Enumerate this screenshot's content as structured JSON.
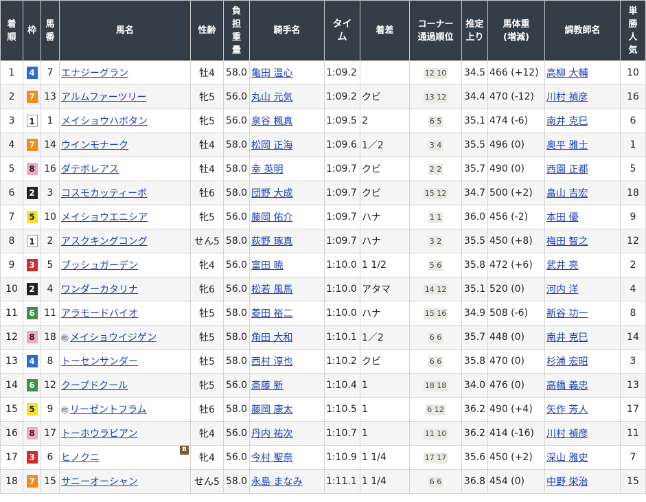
{
  "headers": {
    "rank": "着順",
    "waku": "枠",
    "umaban": "馬番",
    "horse": "馬名",
    "sexage": "性齢",
    "weight": "負担重量",
    "jockey": "騎手名",
    "time": "タイム",
    "margin": "着差",
    "corner": "コーナー通過順位",
    "last3f": "推定上り",
    "body": "馬体重(増減)",
    "trainer": "調教師名",
    "pop": "単勝人気"
  },
  "waku_colors": {
    "1": "#ffffff",
    "2": "#222222",
    "3": "#d3292f",
    "4": "#2d6ad8",
    "5": "#f5e12b",
    "6": "#3a9147",
    "7": "#f08c1c",
    "8": "#f5a8c4"
  },
  "rows": [
    {
      "rank": "1",
      "waku": "4",
      "umaban": "7",
      "marker": "",
      "horse": "エナジーグラン",
      "b": "",
      "sexage": "牡4",
      "weight": "58.0",
      "jockey": "亀田 温心",
      "time": "1:09.2",
      "margin": "",
      "corner": "12 10",
      "last3f": "34.5",
      "body": "466 (+12)",
      "trainer": "高柳 大輔",
      "pop": "10"
    },
    {
      "rank": "2",
      "waku": "7",
      "umaban": "13",
      "marker": "",
      "horse": "アルムファーツリー",
      "b": "",
      "sexage": "牝5",
      "weight": "56.0",
      "jockey": "丸山 元気",
      "time": "1:09.2",
      "margin": "クビ",
      "corner": "13 12",
      "last3f": "34.4",
      "body": "470 (-12)",
      "trainer": "川村 禎彦",
      "pop": "16"
    },
    {
      "rank": "3",
      "waku": "1",
      "umaban": "1",
      "marker": "",
      "horse": "メイショウハボタン",
      "b": "",
      "sexage": "牝5",
      "weight": "56.0",
      "jockey": "泉谷 楓真",
      "time": "1:09.5",
      "margin": "2",
      "corner": "6 5",
      "last3f": "35.1",
      "body": "474 (-6)",
      "trainer": "南井 克巳",
      "pop": "6"
    },
    {
      "rank": "4",
      "waku": "7",
      "umaban": "14",
      "marker": "",
      "horse": "ウインモナーク",
      "b": "",
      "sexage": "牡4",
      "weight": "58.0",
      "jockey": "松岡 正海",
      "time": "1:09.6",
      "margin": "1／2",
      "corner": "3 4",
      "last3f": "35.5",
      "body": "496 (0)",
      "trainer": "奥平 雅士",
      "pop": "1"
    },
    {
      "rank": "5",
      "waku": "8",
      "umaban": "16",
      "marker": "",
      "horse": "ダテボレアス",
      "b": "",
      "sexage": "牡4",
      "weight": "58.0",
      "jockey": "幸 英明",
      "time": "1:09.7",
      "margin": "クビ",
      "corner": "2 2",
      "last3f": "35.7",
      "body": "490 (0)",
      "trainer": "西園 正都",
      "pop": "5"
    },
    {
      "rank": "6",
      "waku": "2",
      "umaban": "3",
      "marker": "",
      "horse": "コスモカッティーボ",
      "b": "",
      "sexage": "牡6",
      "weight": "58.0",
      "jockey": "団野 大成",
      "time": "1:09.7",
      "margin": "クビ",
      "corner": "15 12",
      "last3f": "34.7",
      "body": "500 (+2)",
      "trainer": "畠山 吉宏",
      "pop": "18"
    },
    {
      "rank": "7",
      "waku": "5",
      "umaban": "10",
      "marker": "",
      "horse": "メイショウエニシア",
      "b": "",
      "sexage": "牝5",
      "weight": "56.0",
      "jockey": "藤岡 佑介",
      "time": "1:09.7",
      "margin": "ハナ",
      "corner": "1 1",
      "last3f": "36.0",
      "body": "456 (-2)",
      "trainer": "本田 優",
      "pop": "9"
    },
    {
      "rank": "8",
      "waku": "1",
      "umaban": "2",
      "marker": "",
      "horse": "アスクキングコング",
      "b": "",
      "sexage": "せん5",
      "weight": "58.0",
      "jockey": "荻野 琢真",
      "time": "1:09.7",
      "margin": "ハナ",
      "corner": "3 2",
      "last3f": "35.5",
      "body": "450 (+8)",
      "trainer": "梅田 智之",
      "pop": "12"
    },
    {
      "rank": "9",
      "waku": "3",
      "umaban": "5",
      "marker": "",
      "horse": "ブッシュガーデン",
      "b": "",
      "sexage": "牝4",
      "weight": "56.0",
      "jockey": "富田 暁",
      "time": "1:10.0",
      "margin": "1 1/2",
      "corner": "5 6",
      "last3f": "35.8",
      "body": "472 (+6)",
      "trainer": "武井 亮",
      "pop": "2"
    },
    {
      "rank": "10",
      "waku": "2",
      "umaban": "4",
      "marker": "",
      "horse": "ワンダーカタリナ",
      "b": "",
      "sexage": "牝6",
      "weight": "56.0",
      "jockey": "松若 風馬",
      "time": "1:10.0",
      "margin": "アタマ",
      "corner": "14 12",
      "last3f": "35.1",
      "body": "520 (0)",
      "trainer": "河内 洋",
      "pop": "4"
    },
    {
      "rank": "11",
      "waku": "6",
      "umaban": "11",
      "marker": "",
      "horse": "アラモードバイオ",
      "b": "",
      "sexage": "牡5",
      "weight": "58.0",
      "jockey": "菱田 裕二",
      "time": "1:10.0",
      "margin": "ハナ",
      "corner": "15 16",
      "last3f": "34.9",
      "body": "508 (-6)",
      "trainer": "新谷 功一",
      "pop": "8"
    },
    {
      "rank": "12",
      "waku": "8",
      "umaban": "18",
      "marker": "㊞",
      "horse": "メイショウイジゲン",
      "b": "",
      "sexage": "牡5",
      "weight": "58.0",
      "jockey": "角田 大和",
      "time": "1:10.1",
      "margin": "1／2",
      "corner": "6 6",
      "last3f": "35.7",
      "body": "448 (0)",
      "trainer": "南井 克巳",
      "pop": "14"
    },
    {
      "rank": "13",
      "waku": "4",
      "umaban": "8",
      "marker": "",
      "horse": "トーセンサンダー",
      "b": "",
      "sexage": "牡5",
      "weight": "58.0",
      "jockey": "西村 淳也",
      "time": "1:10.2",
      "margin": "クビ",
      "corner": "6 6",
      "last3f": "35.8",
      "body": "470 (0)",
      "trainer": "杉浦 宏昭",
      "pop": "3"
    },
    {
      "rank": "14",
      "waku": "6",
      "umaban": "12",
      "marker": "",
      "horse": "クープドクール",
      "b": "",
      "sexage": "牝5",
      "weight": "56.0",
      "jockey": "斎藤 新",
      "time": "1:10.4",
      "margin": "1",
      "corner": "18 18",
      "last3f": "34.0",
      "body": "476 (0)",
      "trainer": "高橋 義忠",
      "pop": "13"
    },
    {
      "rank": "15",
      "waku": "5",
      "umaban": "9",
      "marker": "㊞",
      "horse": "リーゼントフラム",
      "b": "",
      "sexage": "牡6",
      "weight": "58.0",
      "jockey": "藤岡 康太",
      "time": "1:10.5",
      "margin": "1",
      "corner": "6 12",
      "last3f": "36.2",
      "body": "490 (+4)",
      "trainer": "矢作 芳人",
      "pop": "17"
    },
    {
      "rank": "16",
      "waku": "8",
      "umaban": "17",
      "marker": "",
      "horse": "トーホウラビアン",
      "b": "",
      "sexage": "牝4",
      "weight": "56.0",
      "jockey": "丹内 祐次",
      "time": "1:10.7",
      "margin": "1",
      "corner": "11 10",
      "last3f": "36.2",
      "body": "414 (-16)",
      "trainer": "川村 禎彦",
      "pop": "11"
    },
    {
      "rank": "17",
      "waku": "3",
      "umaban": "6",
      "marker": "",
      "horse": "ヒノクニ",
      "b": "B",
      "sexage": "牝4",
      "weight": "56.0",
      "jockey": "今村 聖奈",
      "time": "1:10.9",
      "margin": "1 1/4",
      "corner": "17 17",
      "last3f": "35.6",
      "body": "450 (+2)",
      "trainer": "深山 雅史",
      "pop": "7"
    },
    {
      "rank": "18",
      "waku": "7",
      "umaban": "15",
      "marker": "",
      "horse": "サニーオーシャン",
      "b": "",
      "sexage": "せん5",
      "weight": "58.0",
      "jockey": "永島 まなみ",
      "time": "1:11.1",
      "margin": "1 1/4",
      "corner": "6 6",
      "last3f": "36.8",
      "body": "454 (0)",
      "trainer": "中野 栄治",
      "pop": "15"
    }
  ]
}
